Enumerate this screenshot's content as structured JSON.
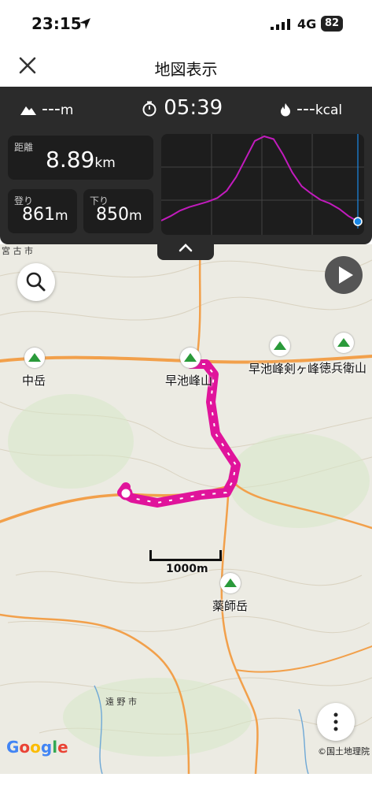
{
  "status_bar": {
    "time": "23:15",
    "network": "4G",
    "battery": "82"
  },
  "header": {
    "title": "地図表示"
  },
  "stats": {
    "altitude_value": "---",
    "altitude_unit": "m",
    "timer": "05:39",
    "calories_value": "---",
    "calories_unit": "kcal",
    "distance_label": "距離",
    "distance_value": "8.89",
    "distance_unit": "km",
    "ascent_label": "登り",
    "ascent_value": "861",
    "ascent_unit": "m",
    "descent_label": "下り",
    "descent_value": "850",
    "descent_unit": "m"
  },
  "chart_data": {
    "type": "line",
    "title": "",
    "series": [
      {
        "values": [
          0.07,
          0.12,
          0.18,
          0.22,
          0.25,
          0.28,
          0.32,
          0.4,
          0.55,
          0.75,
          0.95,
          1.0,
          0.97,
          0.8,
          0.6,
          0.45,
          0.37,
          0.3,
          0.26,
          0.2,
          0.12,
          0.06
        ]
      }
    ],
    "color": "#c21bbd",
    "marker_color": "#1a88e6"
  },
  "map": {
    "labels": {
      "nakadake": "中岳",
      "hayachine": "早池峰山",
      "kengamine": "早池峰剣ヶ峰",
      "tokuhyoe": "徳兵衛山",
      "yakushi": "薬師岳",
      "tono": "遠 野 市",
      "miyako": "宮 古 市"
    },
    "scale": "1000m",
    "google": "Google",
    "attribution": "©国土地理院"
  },
  "colors": {
    "panel_bg": "#2b2b2b",
    "track": "#e0149b",
    "road": "#f2a04b"
  },
  "icons": {
    "close": "close-icon",
    "timer": "stopwatch-icon",
    "mountain": "mountain-icon",
    "flame": "flame-icon",
    "search": "search-icon",
    "play": "play-icon",
    "more": "more-vertical-icon",
    "chevron": "chevron-up-icon"
  }
}
